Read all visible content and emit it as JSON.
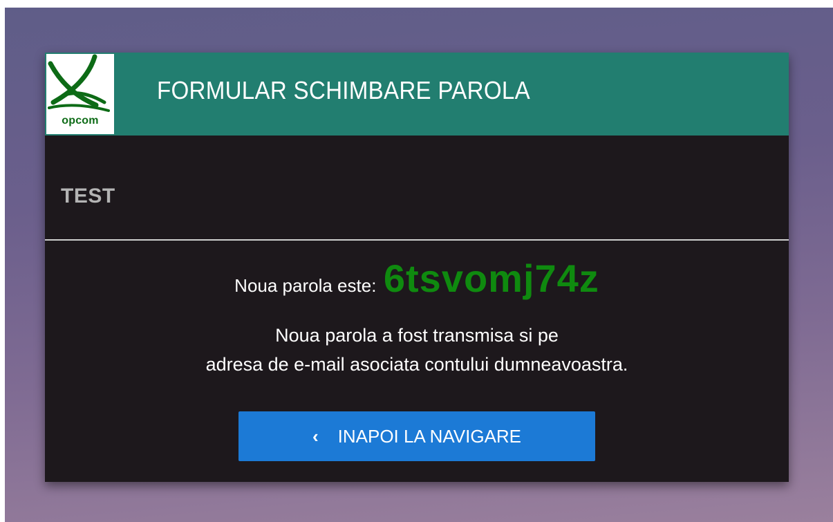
{
  "header": {
    "logo_text": "opcom",
    "logo_subtitle": "",
    "title": "FORMULAR SCHIMBARE PAROLA"
  },
  "section": {
    "label": "TEST"
  },
  "password": {
    "label": "Noua parola este:",
    "value": "6tsvomj74z"
  },
  "info": {
    "line1": "Noua parola a fost transmisa si pe",
    "line2": "adresa de e-mail asociata contului dumneavoastra."
  },
  "back_button": {
    "icon": "chevron-left-icon",
    "label": "INAPOI LA NAVIGARE"
  },
  "colors": {
    "header_bg": "#227e70",
    "card_bg": "#1d181c",
    "password_color": "#0f8a0f",
    "button_bg": "#1c7ad6"
  }
}
